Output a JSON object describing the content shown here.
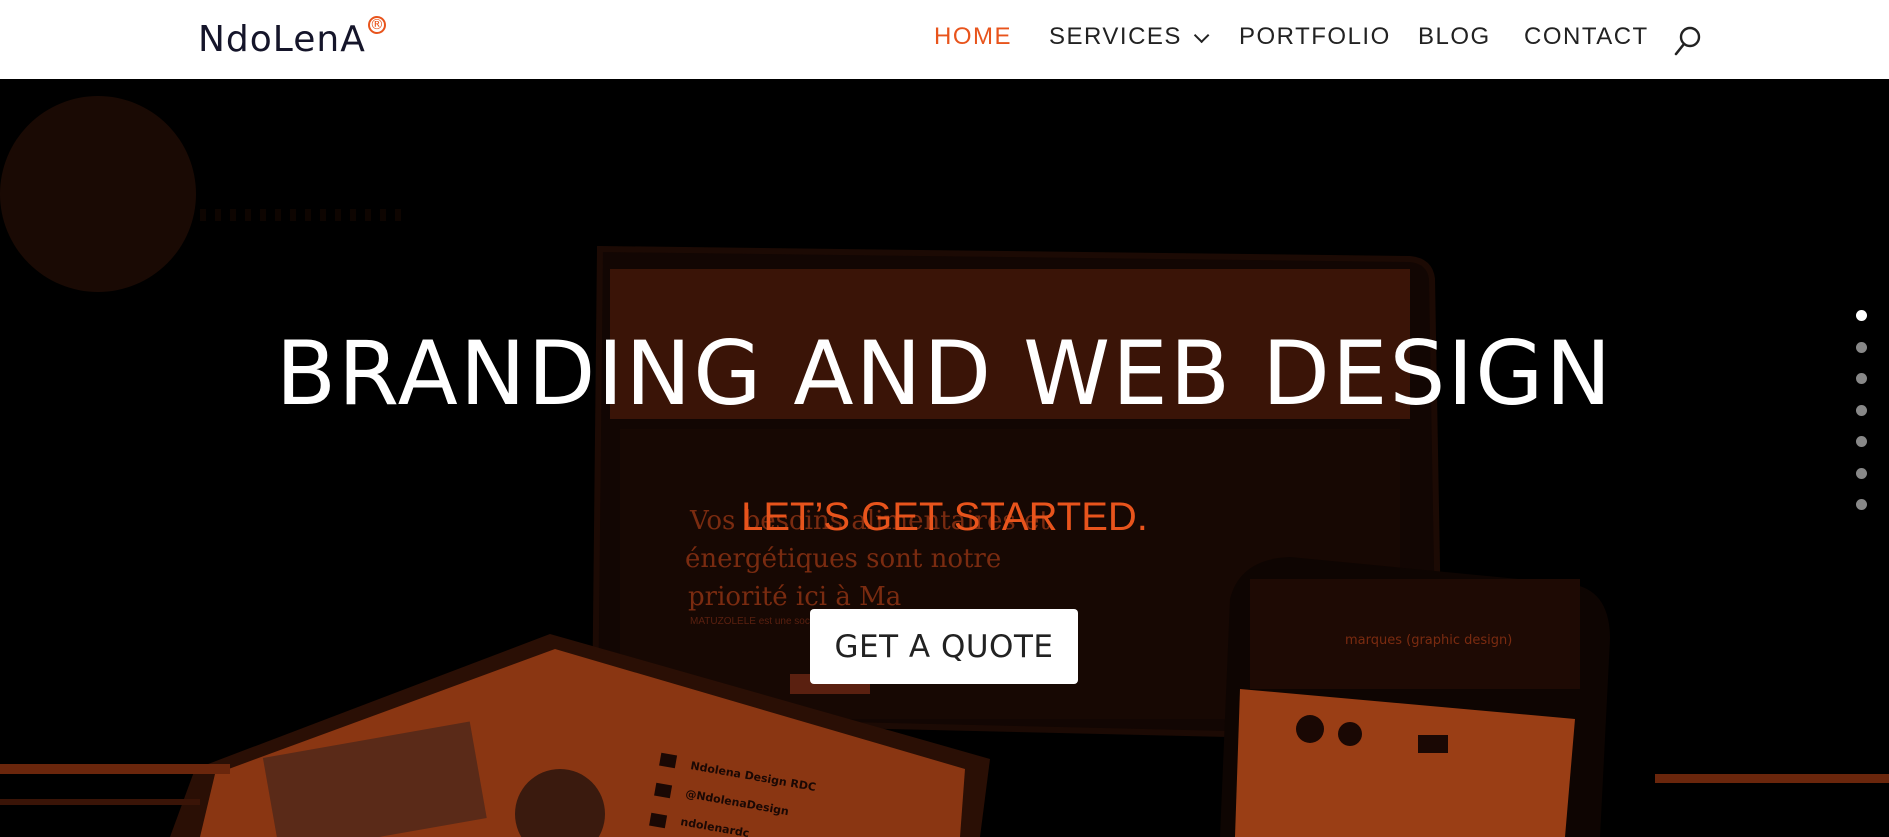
{
  "header": {
    "logo_text": "NdoLenA",
    "logo_mark": "®",
    "nav": {
      "home": "HOME",
      "services": "SERVICES",
      "portfolio": "PORTFOLIO",
      "blog": "BLOG",
      "contact": "CONTACT"
    },
    "search_icon": "search-icon"
  },
  "hero": {
    "headline": "BRANDING AND WEB DESIGN",
    "subheadline": "LET’S GET STARTED.",
    "cta_label": "GET A QUOTE",
    "slide_count": 7,
    "active_slide": 1,
    "background_texts": {
      "laptop_line1": "Vos besoins alimentaires et",
      "laptop_line2": "énergétiques sont notre",
      "laptop_line3": "priorité ici à Ma",
      "laptop_small": "MATUZOLELE est une société",
      "phone_title": "marques (graphic design)",
      "tablet_handle1": "Ndolena Design RDC",
      "tablet_handle2": "@NdolenaDesign",
      "tablet_handle3": "ndolenardc",
      "tablet_handle4": "Ndolena Design"
    }
  },
  "colors": {
    "accent": "#e8541c",
    "overlay": "#000000",
    "text_dark": "#222222"
  }
}
